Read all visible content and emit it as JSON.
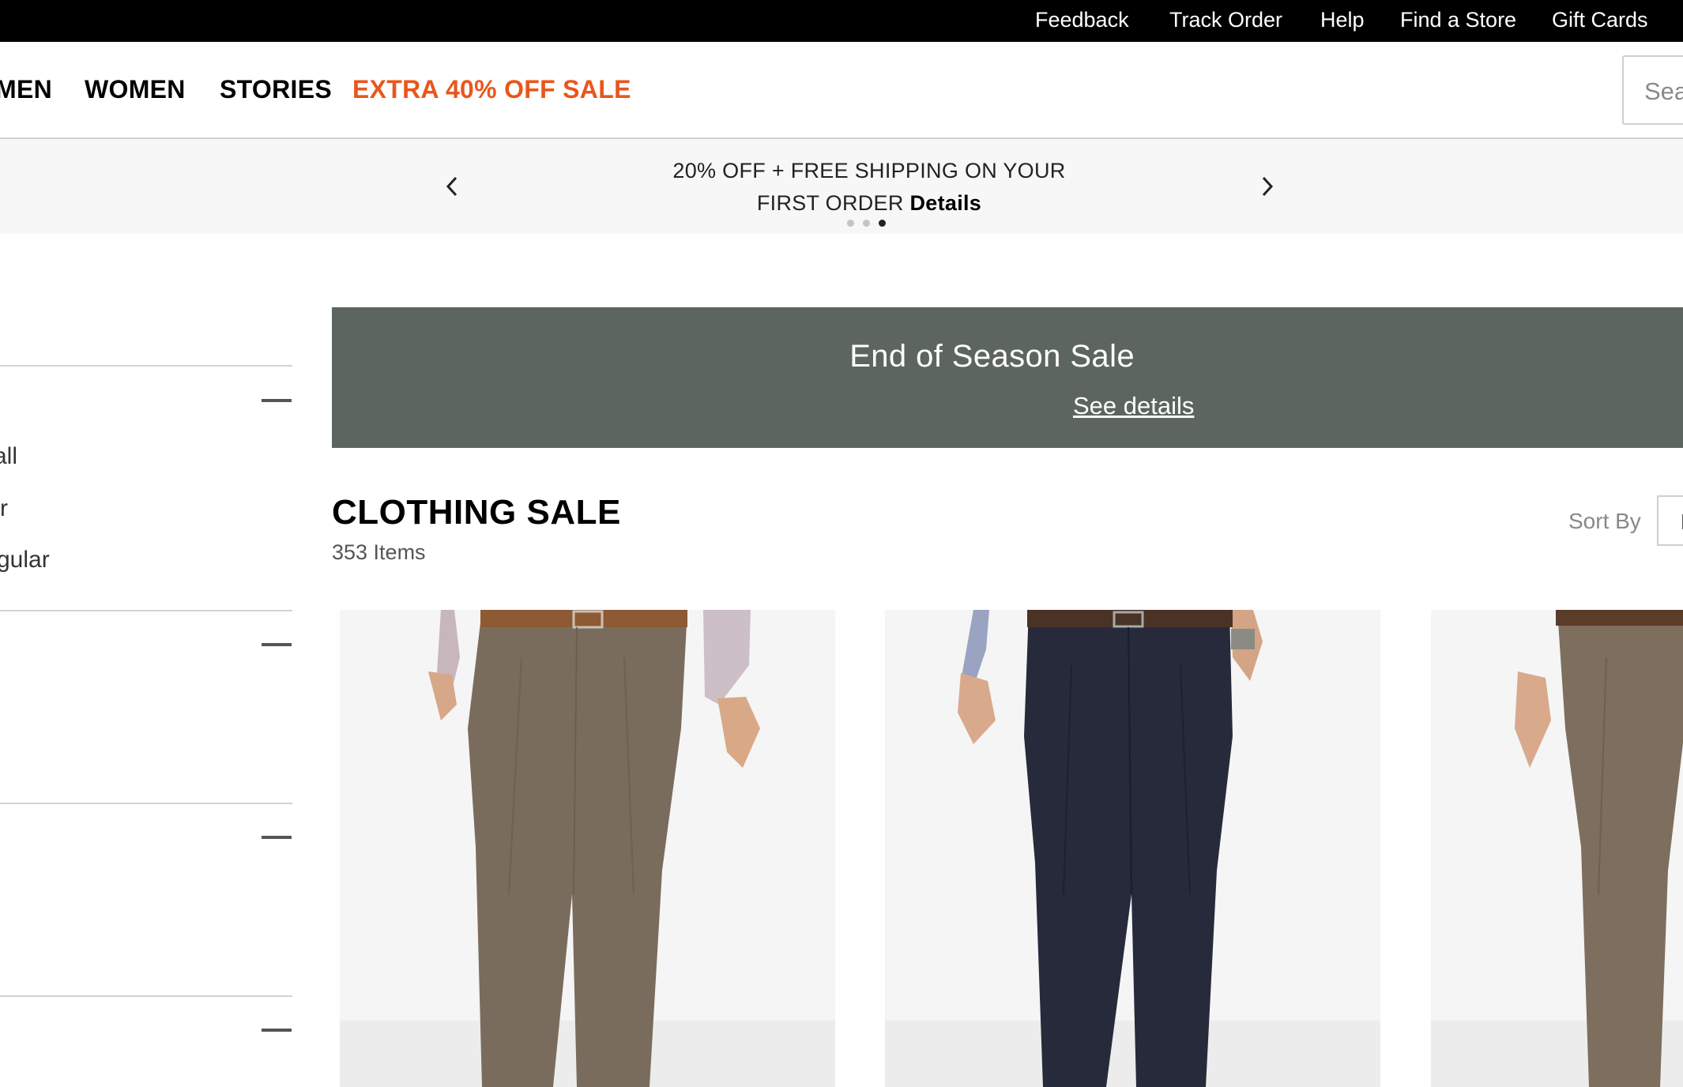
{
  "utility_nav": {
    "links": [
      {
        "label": "Feedback"
      },
      {
        "label": "Track Order"
      },
      {
        "label": "Help"
      },
      {
        "label": "Find a Store"
      },
      {
        "label": "Gift Cards"
      }
    ]
  },
  "main_nav": {
    "items": [
      {
        "label": "MEN"
      },
      {
        "label": "WOMEN"
      },
      {
        "label": "STORIES"
      },
      {
        "label": "EXTRA 40% OFF SALE"
      }
    ],
    "search_placeholder": "Sea"
  },
  "promo": {
    "line1": "20% OFF + FREE SHIPPING ON YOUR",
    "line2": "FIRST ORDER",
    "details_link": "Details",
    "active_slide": 3,
    "slide_count": 3
  },
  "filters": {
    "options": [
      "all",
      "r",
      "gular"
    ]
  },
  "sale_banner": {
    "title": "End of Season Sale",
    "link": "See details",
    "background": "#5d655f"
  },
  "listing": {
    "heading": "CLOTHING SALE",
    "item_count": "353 Items",
    "sort_label": "Sort By",
    "sort_value": "F"
  },
  "colors": {
    "sale_accent": "#e8571c",
    "utility_bar": "#000000",
    "promo_bg": "#f7f7f7"
  },
  "products": [
    {
      "icon": "khaki-pants-image",
      "pants_color": "#7a6c5d"
    },
    {
      "icon": "navy-pants-image",
      "pants_color": "#262a3b"
    },
    {
      "icon": "khaki-pants-image",
      "pants_color": "#7d6e5e"
    }
  ]
}
